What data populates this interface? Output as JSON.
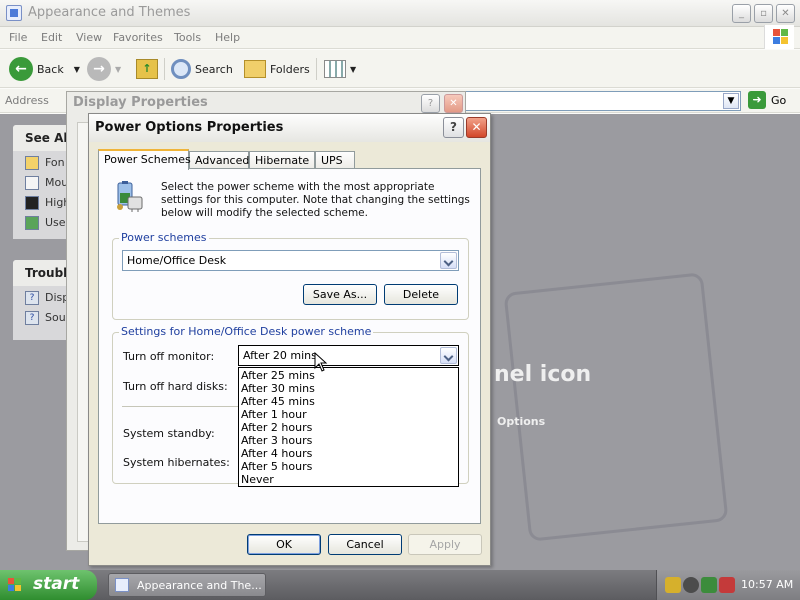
{
  "explorer": {
    "title": "Appearance and Themes",
    "menu": [
      "File",
      "Edit",
      "View",
      "Favorites",
      "Tools",
      "Help"
    ],
    "toolbar": {
      "back": "Back",
      "search": "Search",
      "folders": "Folders"
    },
    "address_label": "Address",
    "go_label": "Go",
    "see_also_title": "See Als",
    "see_also_items": [
      "Fon",
      "Mou",
      "High",
      "Use"
    ],
    "troubleshooters_title": "Trouble",
    "troubleshooter_items": [
      "Disp",
      "Sou"
    ],
    "hint_title": "nel icon",
    "hint_link": "Options"
  },
  "display_dialog": {
    "title": "Display Properties"
  },
  "power_dialog": {
    "title": "Power Options Properties",
    "tabs": [
      "Power Schemes",
      "Advanced",
      "Hibernate",
      "UPS"
    ],
    "description": "Select the power scheme with the most appropriate settings for this computer. Note that changing the settings below will modify the selected scheme.",
    "schemes_group_label": "Power schemes",
    "selected_scheme": "Home/Office Desk",
    "save_as_label": "Save As...",
    "delete_label": "Delete",
    "settings_group_label": "Settings for Home/Office Desk power scheme",
    "turn_off_monitor_label": "Turn off monitor:",
    "turn_off_monitor_value": "After 20 mins",
    "turn_off_hard_disks_label": "Turn off hard disks:",
    "system_standby_label": "System standby:",
    "system_hibernates_label": "System hibernates:",
    "dropdown_options": [
      "After 25 mins",
      "After 30 mins",
      "After 45 mins",
      "After 1 hour",
      "After 2 hours",
      "After 3 hours",
      "After 4 hours",
      "After 5 hours",
      "Never"
    ],
    "ok_label": "OK",
    "cancel_label": "Cancel",
    "apply_label": "Apply"
  },
  "taskbar": {
    "start_label": "start",
    "task_label": "Appearance and The...",
    "clock": "10:57 AM"
  },
  "colors": {
    "accent_blue": "#1f3f9f",
    "close_red": "#d2472a",
    "start_green": "#2f8d2f",
    "tab_highlight": "#f0b438"
  }
}
